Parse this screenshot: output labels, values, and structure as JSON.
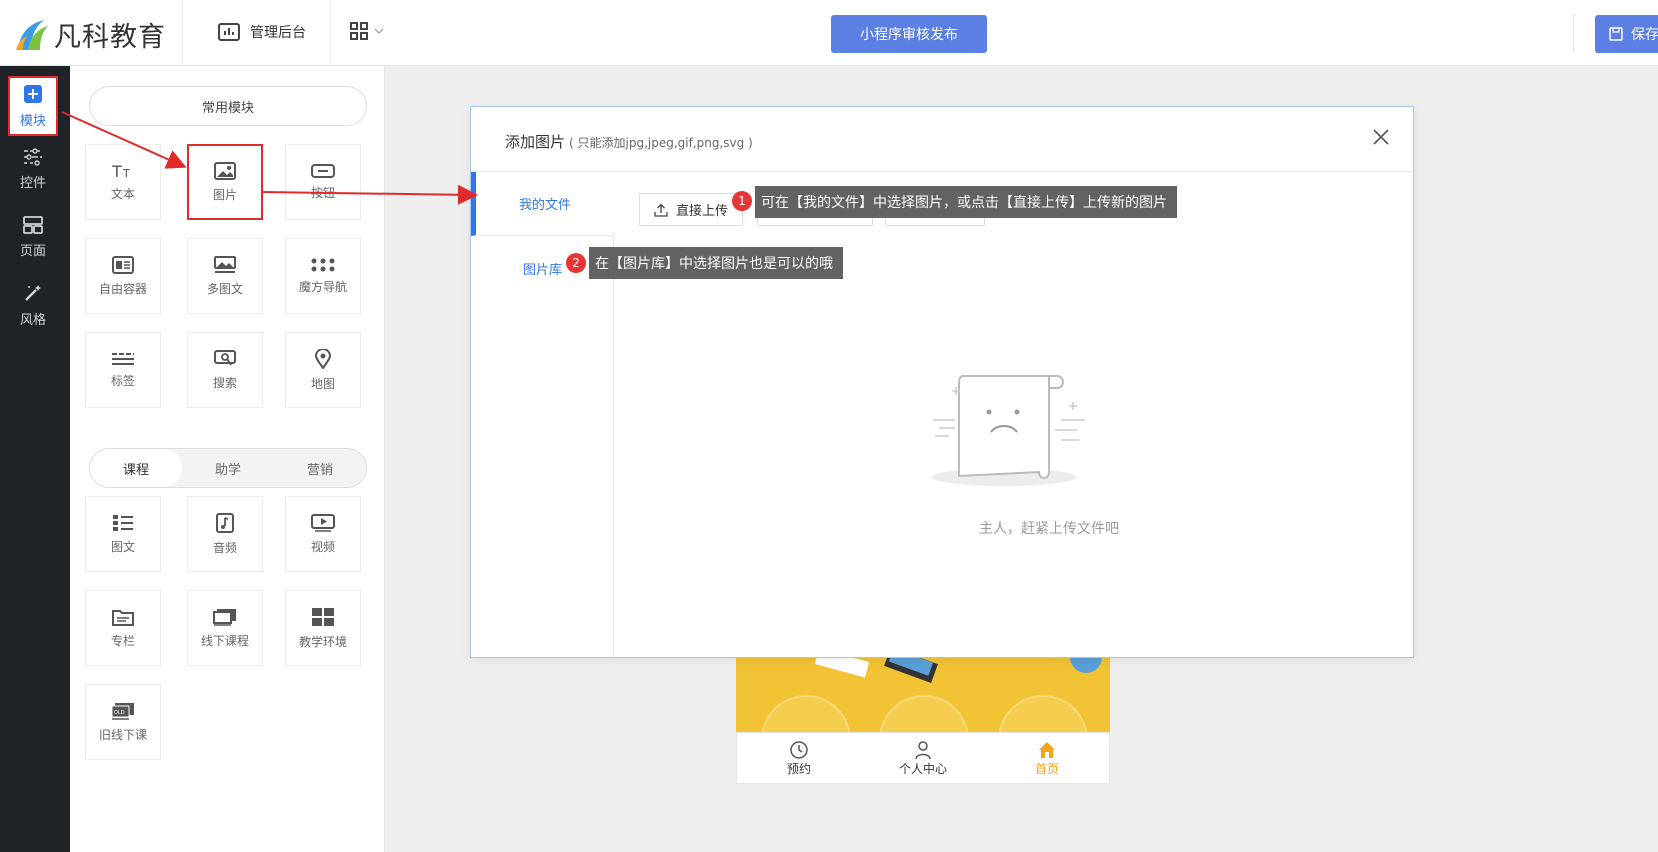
{
  "brand": {
    "name": "凡科教育"
  },
  "topbar": {
    "admin_label": "管理后台",
    "publish_label": "小程序审核发布",
    "save_label": "保存"
  },
  "leftnav": {
    "items": [
      {
        "label": "模块",
        "icon": "plus-square-icon"
      },
      {
        "label": "控件",
        "icon": "sliders-icon"
      },
      {
        "label": "页面",
        "icon": "layout-icon"
      },
      {
        "label": "风格",
        "icon": "magic-wand-icon"
      }
    ]
  },
  "modules": {
    "common_title": "常用模块",
    "common": [
      {
        "label": "文本",
        "icon": "text-icon"
      },
      {
        "label": "图片",
        "icon": "image-icon"
      },
      {
        "label": "按钮",
        "icon": "button-icon"
      },
      {
        "label": "自由容器",
        "icon": "container-icon"
      },
      {
        "label": "多图文",
        "icon": "multi-image-icon"
      },
      {
        "label": "魔方导航",
        "icon": "dots-grid-icon"
      },
      {
        "label": "标签",
        "icon": "tag-lines-icon"
      },
      {
        "label": "搜索",
        "icon": "search-icon"
      },
      {
        "label": "地图",
        "icon": "map-pin-icon"
      }
    ],
    "segments": [
      "课程",
      "助学",
      "营销"
    ],
    "course": [
      {
        "label": "图文",
        "icon": "article-icon"
      },
      {
        "label": "音频",
        "icon": "audio-icon"
      },
      {
        "label": "视频",
        "icon": "video-icon"
      },
      {
        "label": "专栏",
        "icon": "folder-icon"
      },
      {
        "label": "线下课程",
        "icon": "offline-course-icon"
      },
      {
        "label": "教学环境",
        "icon": "environment-icon"
      },
      {
        "label": "旧线下课",
        "icon": "old-offline-icon"
      }
    ]
  },
  "modal": {
    "title": "添加图片",
    "subtitle": "( 只能添加jpg,jpeg,gif,png,svg )",
    "tabs": [
      "我的文件",
      "图片库"
    ],
    "upload_label": "直接上传",
    "tip1": "可在【我的文件】中选择图片，或点击【直接上传】上传新的图片",
    "tip2": "在【图片库】中选择图片也是可以的哦",
    "badge1": "1",
    "badge2": "2",
    "empty_text": "主人，赶紧上传文件吧"
  },
  "phone_tabbar": [
    {
      "label": "预约",
      "icon": "clock-icon"
    },
    {
      "label": "个人中心",
      "icon": "user-icon"
    },
    {
      "label": "首页",
      "icon": "home-icon"
    }
  ],
  "colors": {
    "accent": "#2f77e8",
    "primary_button": "#5b7fe2",
    "highlight_red": "#e02b2b",
    "sidebar_dark": "#1f2227",
    "phone_yellow": "#f2c335"
  }
}
